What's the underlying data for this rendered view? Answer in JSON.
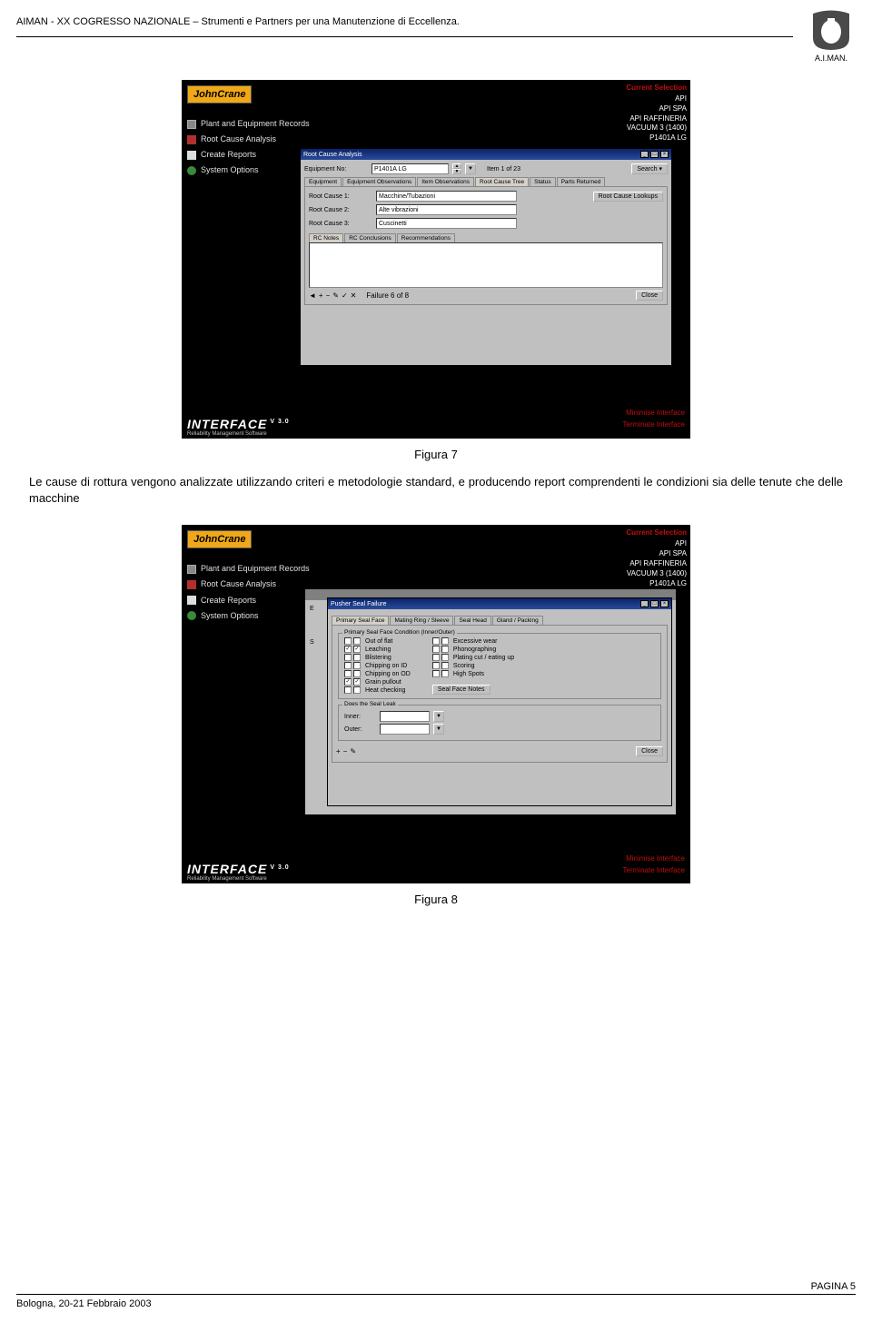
{
  "header": {
    "text": "AIMAN - XX COGRESSO NAZIONALE – Strumenti e Partners per una Manutenzione di Eccellenza.",
    "org_logo_text": "A.I.MAN."
  },
  "fig7": {
    "caption": "Figura 7",
    "logo": "JohnCrane",
    "current_selection_label": "Current Selection",
    "selection_items": [
      "API",
      "API SPA",
      "API RAFFINERIA",
      "VACUUM 3 (1400)",
      "P1401A LG"
    ],
    "nav_items": [
      "Plant and Equipment Records",
      "Root Cause Analysis",
      "Create Reports",
      "System Options"
    ],
    "interface_brand": "INTERFACE",
    "interface_version": "V 3.0",
    "interface_sub": "Reliability Management Software",
    "red_links": [
      "Minimise Interface",
      "Terminate Interface"
    ],
    "window": {
      "title": "Root Cause Analysis",
      "equip_label": "Equipment No:",
      "equip_value": "P1401A LG",
      "item_of": "Item 1 of 23",
      "search_btn": "Search",
      "tabs": [
        "Equipment",
        "Equipment Observations",
        "Item Observations",
        "Root Cause Tree",
        "Status",
        "Parts Returned"
      ],
      "active_tab": 3,
      "rc1_label": "Root Cause 1:",
      "rc1_value": "Macchine/Tubazioni",
      "rc2_label": "Root Cause 2:",
      "rc2_value": "Alte vibrazioni",
      "rc3_label": "Root Cause 3:",
      "rc3_value": "Cuscinetti",
      "lookup_btn": "Root Cause Lookups",
      "sub_tabs": [
        "RC Notes",
        "RC Conclusions",
        "Recommendations"
      ],
      "failure_counter": "Failure 6 of 8",
      "close_btn": "Close"
    }
  },
  "body_paragraph": "Le cause di rottura vengono analizzate utilizzando criteri e metodologie standard, e producendo report comprendenti le condizioni sia delle tenute che delle macchine",
  "fig8": {
    "caption": "Figura 8",
    "logo": "JohnCrane",
    "current_selection_label": "Current Selection",
    "selection_items": [
      "API",
      "API SPA",
      "API RAFFINERIA",
      "VACUUM 3 (1400)",
      "P1401A LG"
    ],
    "nav_items": [
      "Plant and Equipment Records",
      "Root Cause Analysis",
      "Create Reports",
      "System Options"
    ],
    "interface_brand": "INTERFACE",
    "interface_version": "V 3.0",
    "interface_sub": "Reliability Management Software",
    "red_links": [
      "Minimise Interface",
      "Terminate Interface"
    ],
    "window": {
      "title": "Pusher Seal Failure",
      "tabs": [
        "Primary Seal Face",
        "Mating Ring / Sleeve",
        "Seal Head",
        "Gland / Packing"
      ],
      "active_tab": 0,
      "group_legend": "Primary Seal Face Condition (Inner/Outer)",
      "left_checks": [
        {
          "label": "Out of flat",
          "inner": false,
          "outer": false
        },
        {
          "label": "Leaching",
          "inner": true,
          "outer": true
        },
        {
          "label": "Blistering",
          "inner": false,
          "outer": false
        },
        {
          "label": "Chipping on ID",
          "inner": false,
          "outer": false
        },
        {
          "label": "Chipping on OD",
          "inner": false,
          "outer": false
        },
        {
          "label": "Grain pullout",
          "inner": true,
          "outer": true
        },
        {
          "label": "Heat checking",
          "inner": false,
          "outer": false
        }
      ],
      "right_checks": [
        {
          "label": "Excessive wear",
          "inner": false,
          "outer": false
        },
        {
          "label": "Phonographing",
          "inner": false,
          "outer": false
        },
        {
          "label": "Plating cut / eating up",
          "inner": false,
          "outer": false
        },
        {
          "label": "Scoring",
          "inner": false,
          "outer": false
        },
        {
          "label": "High Spots",
          "inner": false,
          "outer": false
        }
      ],
      "seal_face_notes_btn": "Seal Face Notes",
      "leak_label": "Does the Seal Leak",
      "inner_label": "Inner:",
      "outer_label": "Outer:",
      "close_btn": "Close"
    }
  },
  "footer": {
    "left": "Bologna, 20-21 Febbraio 2003",
    "right": "PAGINA 5"
  }
}
